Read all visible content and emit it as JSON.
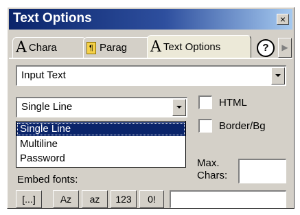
{
  "window": {
    "title": "Text Options",
    "close_label": "×"
  },
  "tabs": [
    {
      "icon": "A",
      "label": "Chara"
    },
    {
      "icon": "¶",
      "label": "Parag"
    },
    {
      "icon": "A",
      "label": "Text Options"
    }
  ],
  "help_label": "?",
  "scroll_arrow": "▶",
  "text_type": {
    "value": "Input Text"
  },
  "line_type": {
    "value": "Single Line",
    "options": [
      "Single Line",
      "Multiline",
      "Password"
    ]
  },
  "checkboxes": {
    "html_label": "HTML",
    "border_label": "Border/Bg"
  },
  "max_chars": {
    "label_line1": "Max.",
    "label_line2": "Chars:",
    "value": ""
  },
  "embed": {
    "label": "Embed fonts:",
    "buttons": [
      "[...]",
      "Az",
      "az",
      "123",
      "0!"
    ],
    "chars_value": ""
  }
}
